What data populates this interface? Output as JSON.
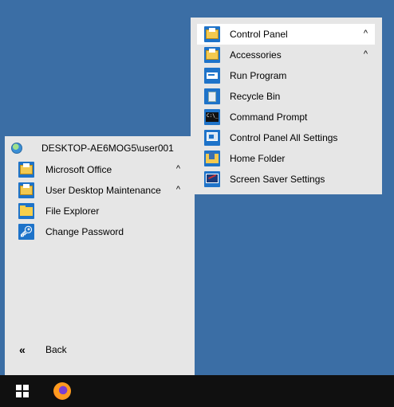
{
  "user": {
    "label": "DESKTOP-AE6MOG5\\user001"
  },
  "start_menu": {
    "items": [
      {
        "label": "Microsoft Office",
        "icon": "folder-icon",
        "has_submenu": true,
        "chevron": "^"
      },
      {
        "label": "User Desktop Maintenance",
        "icon": "folder-icon",
        "has_submenu": true,
        "chevron": "^"
      },
      {
        "label": "File Explorer",
        "icon": "file-explorer-icon",
        "has_submenu": false,
        "chevron": ""
      },
      {
        "label": "Change Password",
        "icon": "change-password-icon",
        "has_submenu": false,
        "chevron": ""
      }
    ],
    "back_label": "Back",
    "back_glyph": "«"
  },
  "submenu": {
    "items": [
      {
        "label": "Control Panel",
        "icon": "folder-icon",
        "has_submenu": true,
        "chevron": "^",
        "selected": true
      },
      {
        "label": "Accessories",
        "icon": "folder-icon",
        "has_submenu": true,
        "chevron": "^",
        "selected": false
      },
      {
        "label": "Run Program",
        "icon": "run-icon",
        "has_submenu": false,
        "chevron": ""
      },
      {
        "label": "Recycle Bin",
        "icon": "recycle-bin-icon",
        "has_submenu": false,
        "chevron": ""
      },
      {
        "label": "Command Prompt",
        "icon": "command-prompt-icon",
        "has_submenu": false,
        "chevron": ""
      },
      {
        "label": "Control Panel All Settings",
        "icon": "control-panel-settings-icon",
        "has_submenu": false,
        "chevron": ""
      },
      {
        "label": "Home Folder",
        "icon": "home-folder-icon",
        "has_submenu": false,
        "chevron": ""
      },
      {
        "label": "Screen Saver Settings",
        "icon": "screen-saver-icon",
        "has_submenu": false,
        "chevron": ""
      }
    ]
  },
  "taskbar": {
    "start_icon": "windows-logo-icon",
    "pinned": [
      {
        "icon": "firefox-icon"
      }
    ]
  },
  "colors": {
    "desktop": "#3b6ea5",
    "menu_bg": "#e6e6e6",
    "taskbar_bg": "#101010",
    "tile_blue": "#1e73c9",
    "selected_bg": "#ffffff"
  }
}
